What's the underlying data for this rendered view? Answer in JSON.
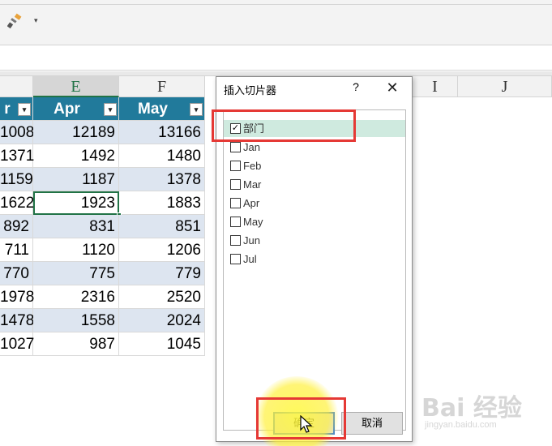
{
  "ribbon": {
    "icons": [
      "format-painter-icon",
      "quick-access-dropdown-icon"
    ]
  },
  "columns": {
    "e": "E",
    "f": "F",
    "i": "I",
    "j": "J"
  },
  "table": {
    "headers": [
      "r",
      "Apr",
      "May"
    ],
    "rows": [
      [
        "1008",
        "12189",
        "13166"
      ],
      [
        "1371",
        "1492",
        "1480"
      ],
      [
        "1159",
        "1187",
        "1378"
      ],
      [
        "1622",
        "1923",
        "1883"
      ],
      [
        "892",
        "831",
        "851"
      ],
      [
        "711",
        "1120",
        "1206"
      ],
      [
        "770",
        "775",
        "779"
      ],
      [
        "1978",
        "2316",
        "2520"
      ],
      [
        "1478",
        "1558",
        "2024"
      ],
      [
        "1027",
        "987",
        "1045"
      ]
    ],
    "colors": {
      "header": "#217a9b",
      "band": "#dde5f0",
      "active_border": "#217346"
    }
  },
  "dialog": {
    "title": "插入切片器",
    "help": "?",
    "close": "✕",
    "items": [
      {
        "label": "部门",
        "checked": true
      },
      {
        "label": "Jan",
        "checked": false
      },
      {
        "label": "Feb",
        "checked": false
      },
      {
        "label": "Mar",
        "checked": false
      },
      {
        "label": "Apr",
        "checked": false
      },
      {
        "label": "May",
        "checked": false
      },
      {
        "label": "Jun",
        "checked": false
      },
      {
        "label": "Jul",
        "checked": false
      }
    ],
    "ok": "确定",
    "cancel": "取消"
  },
  "watermark": {
    "main": "Bai 经验",
    "sub": "jingyan.baidu.com"
  },
  "colors": {
    "highlight": "#e53935",
    "spotlight": "#fff23c"
  }
}
